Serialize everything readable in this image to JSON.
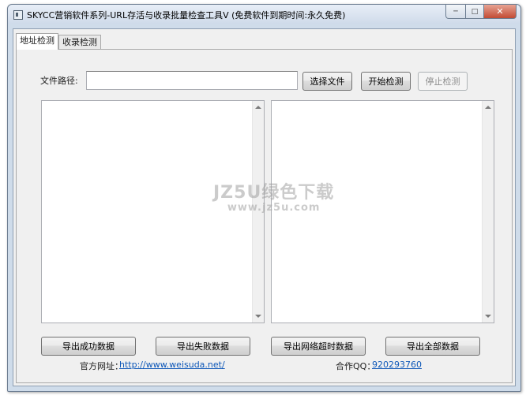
{
  "window": {
    "title": "SKYCC营销软件系列-URL存活与收录批量检查工具V (免费软件到期时间:永久免费)",
    "controls": {
      "minimize": "─",
      "maximize": "□",
      "close": "✕"
    }
  },
  "tabs": [
    {
      "label": "地址检测",
      "active": true
    },
    {
      "label": "收录检测",
      "active": false
    }
  ],
  "file": {
    "label": "文件路径:",
    "value": "",
    "placeholder": ""
  },
  "buttons": {
    "choose_file": "选择文件",
    "start": "开始检测",
    "stop": "停止检测"
  },
  "export": {
    "success": "导出成功数据",
    "failed": "导出失败数据",
    "timeout": "导出网络超时数据",
    "all": "导出全部数据"
  },
  "footer": {
    "site_label": "官方网址：",
    "site_url": "http://www.weisuda.net/",
    "qq_label": "合作QQ：",
    "qq_number": "920293760"
  },
  "watermark": {
    "line1": "JZ5U绿色下载",
    "line2": "www.jz5u.com"
  },
  "colors": {
    "link": "#0d57b8",
    "titlebar": "#cfdbea",
    "close_button": "#c24b34"
  }
}
